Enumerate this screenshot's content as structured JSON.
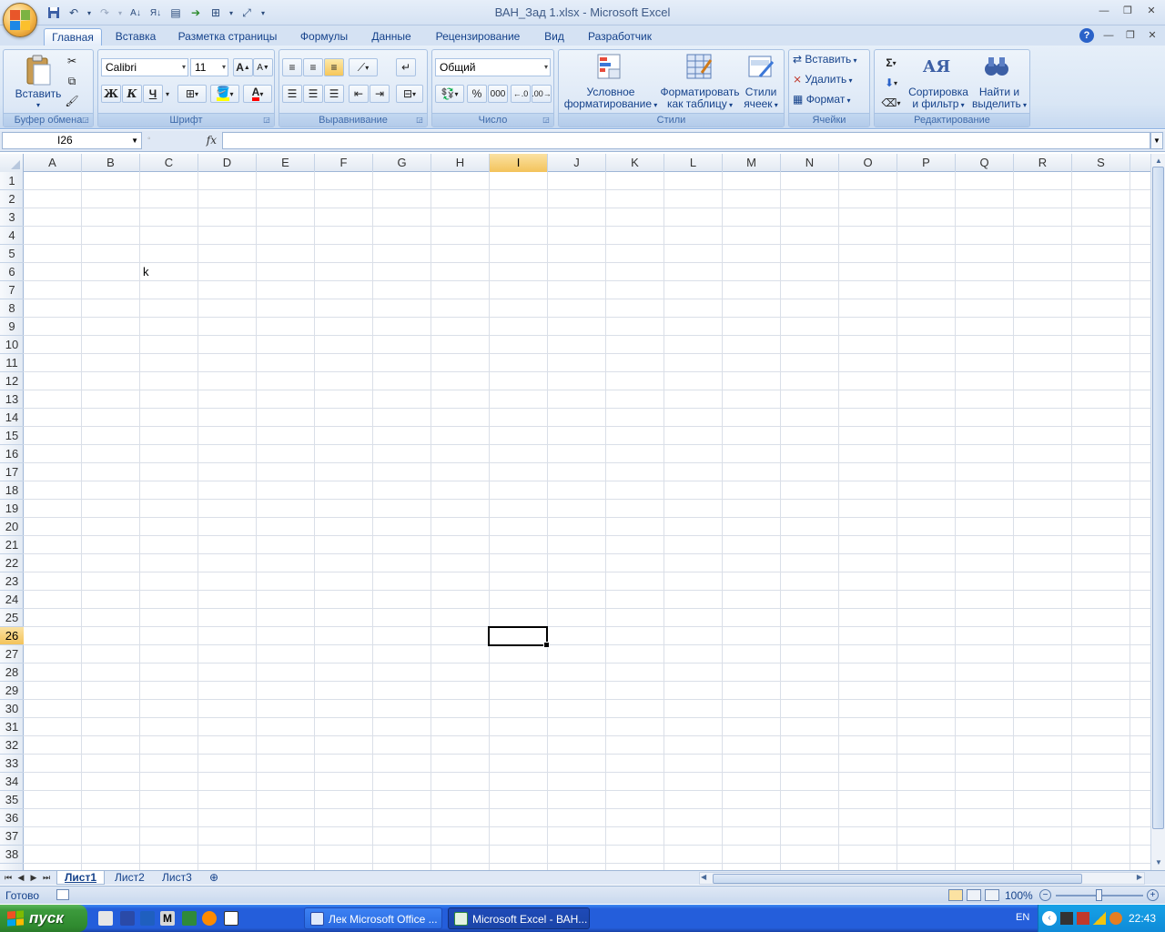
{
  "window": {
    "title": "ВАН_Зад 1.xlsx - Microsoft Excel"
  },
  "ribbon_tabs": [
    "Главная",
    "Вставка",
    "Разметка страницы",
    "Формулы",
    "Данные",
    "Рецензирование",
    "Вид",
    "Разработчик"
  ],
  "active_tab": "Главная",
  "clipboard": {
    "paste_label": "Вставить",
    "group_label": "Буфер обмена"
  },
  "font": {
    "name": "Calibri",
    "size": "11",
    "bold": "Ж",
    "italic": "К",
    "underline": "Ч",
    "group_label": "Шрифт",
    "grow": "A",
    "shrink": "A",
    "font_color_letter": "A"
  },
  "alignment": {
    "group_label": "Выравнивание"
  },
  "number": {
    "format": "Общий",
    "percent": "%",
    "thousands": "000",
    "group_label": "Число"
  },
  "styles": {
    "conditional_line1": "Условное",
    "conditional_line2": "форматирование",
    "format_table_line1": "Форматировать",
    "format_table_line2": "как таблицу",
    "cell_styles_line1": "Стили",
    "cell_styles_line2": "ячеек",
    "group_label": "Стили"
  },
  "cells": {
    "insert": "Вставить",
    "delete": "Удалить",
    "format": "Формат",
    "group_label": "Ячейки"
  },
  "editing": {
    "sort_line1": "Сортировка",
    "sort_line2": "и фильтр",
    "find_line1": "Найти и",
    "find_line2": "выделить",
    "group_label": "Редактирование"
  },
  "formula_bar": {
    "name_box": "I26",
    "fx": "fx",
    "formula": ""
  },
  "columns": [
    "A",
    "B",
    "C",
    "D",
    "E",
    "F",
    "G",
    "H",
    "I",
    "J",
    "K",
    "L",
    "M",
    "N",
    "O",
    "P",
    "Q",
    "R",
    "S"
  ],
  "rows": [
    "1",
    "2",
    "3",
    "4",
    "5",
    "6",
    "7",
    "8",
    "9",
    "10",
    "11",
    "12",
    "13",
    "14",
    "15",
    "16",
    "17",
    "18",
    "19",
    "20",
    "21",
    "22",
    "23",
    "24",
    "25",
    "26",
    "27",
    "28",
    "29",
    "30",
    "31",
    "32",
    "33",
    "34",
    "35",
    "36",
    "37",
    "38"
  ],
  "selected_cell": {
    "column": "I",
    "row": "26"
  },
  "cell_values": {
    "C6": "k"
  },
  "sheets": [
    "Лист1",
    "Лист2",
    "Лист3"
  ],
  "active_sheet": "Лист1",
  "status": {
    "text": "Готово",
    "zoom": "100%"
  },
  "taskbar": {
    "start": "пуск",
    "tasks": [
      "Лек Microsoft Office ...",
      "Microsoft Excel - ВАН..."
    ],
    "language": "EN",
    "clock": "22:43"
  },
  "colors": {
    "ribbon_bg": "#d9e6f5",
    "selected_header": "#f3c35b",
    "taskbar": "#245edb",
    "start_green": "#3c9a3c"
  }
}
